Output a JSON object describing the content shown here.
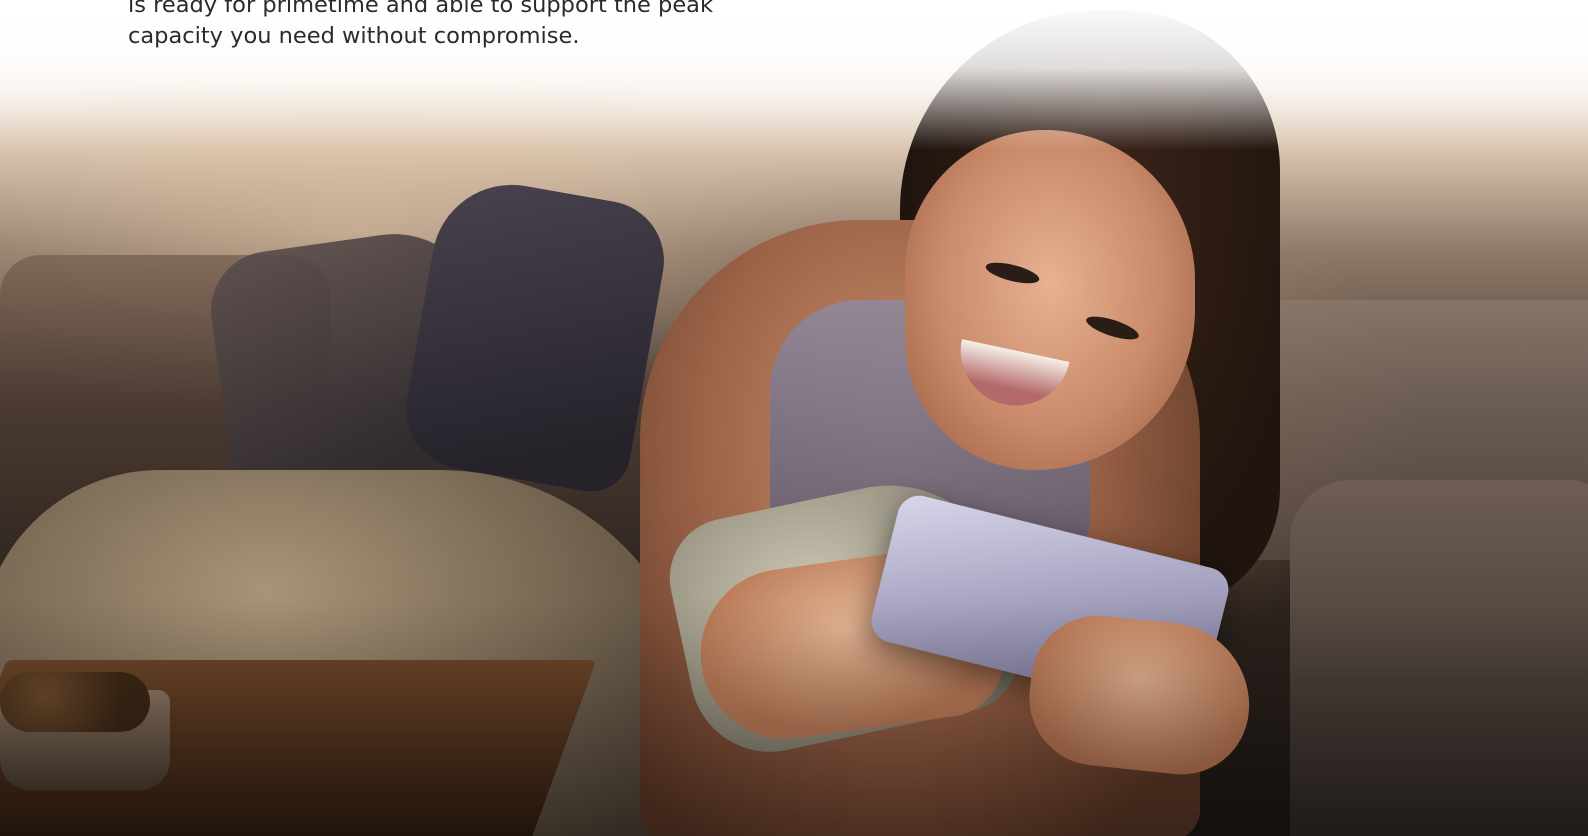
{
  "intro": {
    "line1": "is ready for primetime and able to support the peak",
    "line2": "capacity you need without compromise."
  },
  "hero": {
    "subject": "woman smiling while holding a phone horizontally, lying on a couch under a blanket"
  },
  "colors": {
    "text": "#2b2b2b",
    "background": "#ffffff"
  }
}
